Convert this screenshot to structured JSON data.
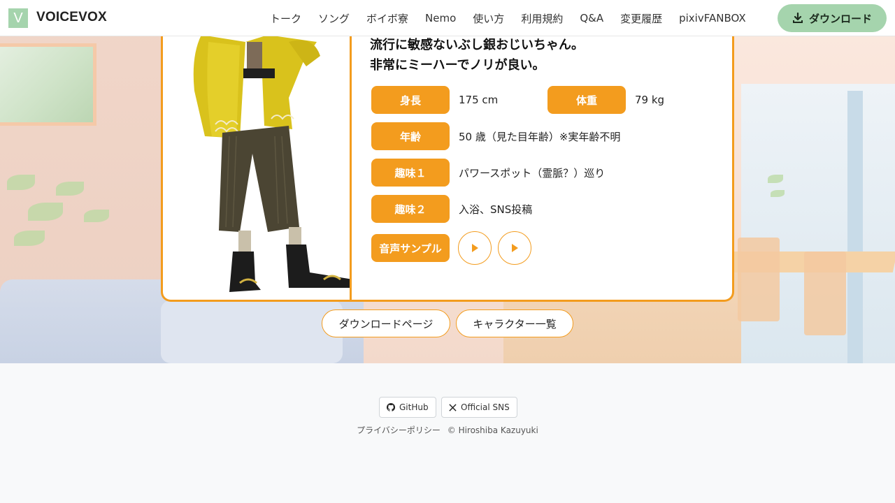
{
  "header": {
    "logo_letter": "V",
    "brand": "VOICEVOX",
    "nav": [
      "トーク",
      "ソング",
      "ボイボ寮",
      "Nemo",
      "使い方",
      "利用規約",
      "Q&A",
      "変更履歴",
      "pixivFANBOX"
    ],
    "download_label": "ダウンロード"
  },
  "profile": {
    "description_lines": [
      "流行に敏感ないぶし銀おじいちゃん。",
      "非常にミーハーでノリが良い。"
    ],
    "height_label": "身長",
    "height_value": "175 cm",
    "weight_label": "体重",
    "weight_value": "79 kg",
    "age_label": "年齢",
    "age_value": "50 歳（見た目年齢）※実年齢不明",
    "hobby1_label": "趣味１",
    "hobby1_value": "パワースポット（霊脈？）巡り",
    "hobby2_label": "趣味２",
    "hobby2_value": "入浴、SNS投稿",
    "sample_label": "音声サンプル"
  },
  "actions": {
    "download_page": "ダウンロードページ",
    "character_list": "キャラクター一覧"
  },
  "footer": {
    "github": "GitHub",
    "sns": "Official SNS",
    "privacy": "プライバシーポリシー",
    "copyright": "© Hiroshiba Kazuyuki"
  },
  "colors": {
    "accent_orange": "#f39c1e",
    "accent_green": "#a5d4ad"
  },
  "icons": [
    "download-icon",
    "play-icon",
    "github-icon",
    "x-icon"
  ]
}
